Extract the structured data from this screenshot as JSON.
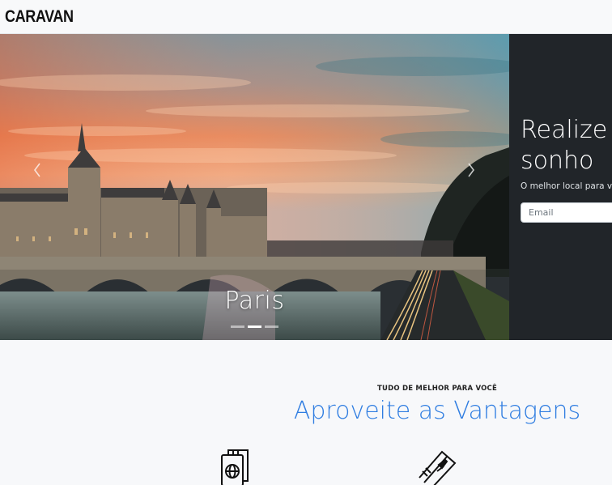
{
  "navbar": {
    "brand": "CARAVAN"
  },
  "carousel": {
    "caption": "Paris",
    "slide_count": 3,
    "active_slide": 1,
    "prev_label": "Previous",
    "next_label": "Next"
  },
  "side_panel": {
    "title_line1": "Realize a",
    "title_line2": "sonho",
    "subtitle": "O melhor local para viajar",
    "email_placeholder": "Email"
  },
  "benefits": {
    "eyebrow": "TUDO DE MELHOR PARA VOCÊ",
    "title": "Aproveite as Vantagens",
    "icons": [
      "passport-icon",
      "plane-ticket-icon"
    ]
  },
  "colors": {
    "accent": "#2f7de1",
    "panel": "#212529",
    "navbar": "#f8f9fa"
  }
}
